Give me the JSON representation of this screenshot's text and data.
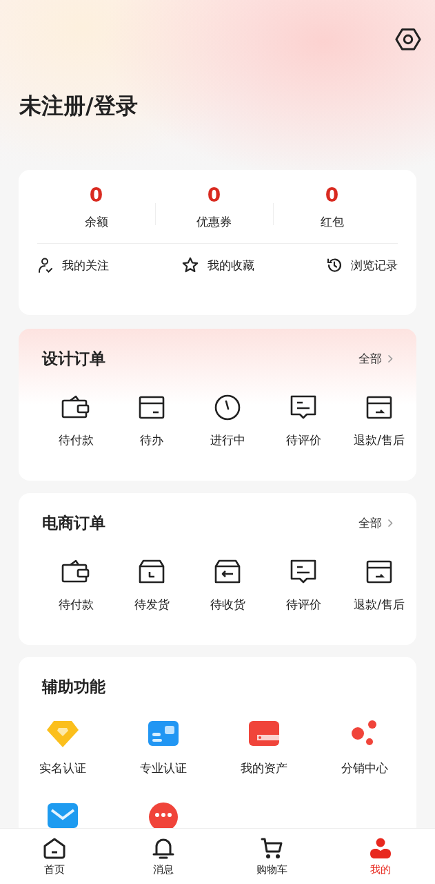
{
  "header": {
    "title": "未注册/登录"
  },
  "stats": [
    {
      "value": "0",
      "label": "余额"
    },
    {
      "value": "0",
      "label": "优惠券"
    },
    {
      "value": "0",
      "label": "红包"
    }
  ],
  "quick_links": [
    {
      "kind": "follow",
      "label": "我的关注"
    },
    {
      "kind": "star",
      "label": "我的收藏"
    },
    {
      "kind": "history",
      "label": "浏览记录"
    }
  ],
  "order_sections": [
    {
      "title": "设计订单",
      "more": "全部",
      "highlight": true,
      "items": [
        {
          "kind": "wallet",
          "label": "待付款"
        },
        {
          "kind": "card",
          "label": "待办"
        },
        {
          "kind": "clock",
          "label": "进行中"
        },
        {
          "kind": "comment",
          "label": "待评价"
        },
        {
          "kind": "refund",
          "label": "退款/售后"
        }
      ]
    },
    {
      "title": "电商订单",
      "more": "全部",
      "highlight": false,
      "items": [
        {
          "kind": "wallet",
          "label": "待付款"
        },
        {
          "kind": "box",
          "label": "待发货"
        },
        {
          "kind": "inbox",
          "label": "待收货"
        },
        {
          "kind": "comment",
          "label": "待评价"
        },
        {
          "kind": "refund",
          "label": "退款/售后"
        }
      ]
    }
  ],
  "aux": {
    "title": "辅助功能",
    "items": [
      {
        "kind": "diamond",
        "label": "实名认证"
      },
      {
        "kind": "idcard",
        "label": "专业认证"
      },
      {
        "kind": "asset",
        "label": "我的资产"
      },
      {
        "kind": "share",
        "label": "分销中心"
      },
      {
        "kind": "mail"
      },
      {
        "kind": "chat"
      }
    ]
  },
  "tab_bar": [
    {
      "kind": "home",
      "label": "首页",
      "selected": false
    },
    {
      "kind": "bell",
      "label": "消息",
      "selected": false
    },
    {
      "kind": "cart",
      "label": "购物车",
      "selected": false
    },
    {
      "kind": "user",
      "label": "我的",
      "selected": true
    }
  ]
}
